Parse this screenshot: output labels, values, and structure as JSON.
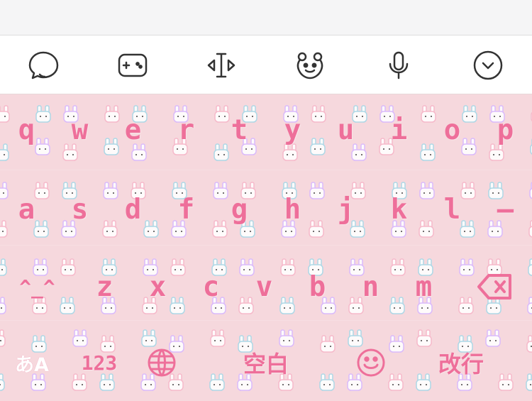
{
  "toolbar": {
    "tools": [
      "chat-bubble-icon",
      "gamepad-icon",
      "text-cursor-icon",
      "bear-face-icon",
      "microphone-icon",
      "chevron-down-icon"
    ]
  },
  "keyboard": {
    "row1": [
      "q",
      "w",
      "e",
      "r",
      "t",
      "y",
      "u",
      "i",
      "o",
      "p"
    ],
    "row2": [
      "a",
      "s",
      "d",
      "f",
      "g",
      "h",
      "j",
      "k",
      "l",
      "—"
    ],
    "row3": {
      "shift": "^_^",
      "letters": [
        "z",
        "x",
        "c",
        "v",
        "b",
        "n",
        "m"
      ]
    },
    "row4": {
      "kana": "あA",
      "numbers": "123",
      "space": "空白",
      "return": "改行"
    }
  },
  "colors": {
    "background": "#f6d8dd",
    "key_text": "#ee6f9a",
    "bunny_pink": "#f6b6c9",
    "bunny_blue": "#a6d8e8",
    "bunny_purple": "#d8b7ff"
  }
}
